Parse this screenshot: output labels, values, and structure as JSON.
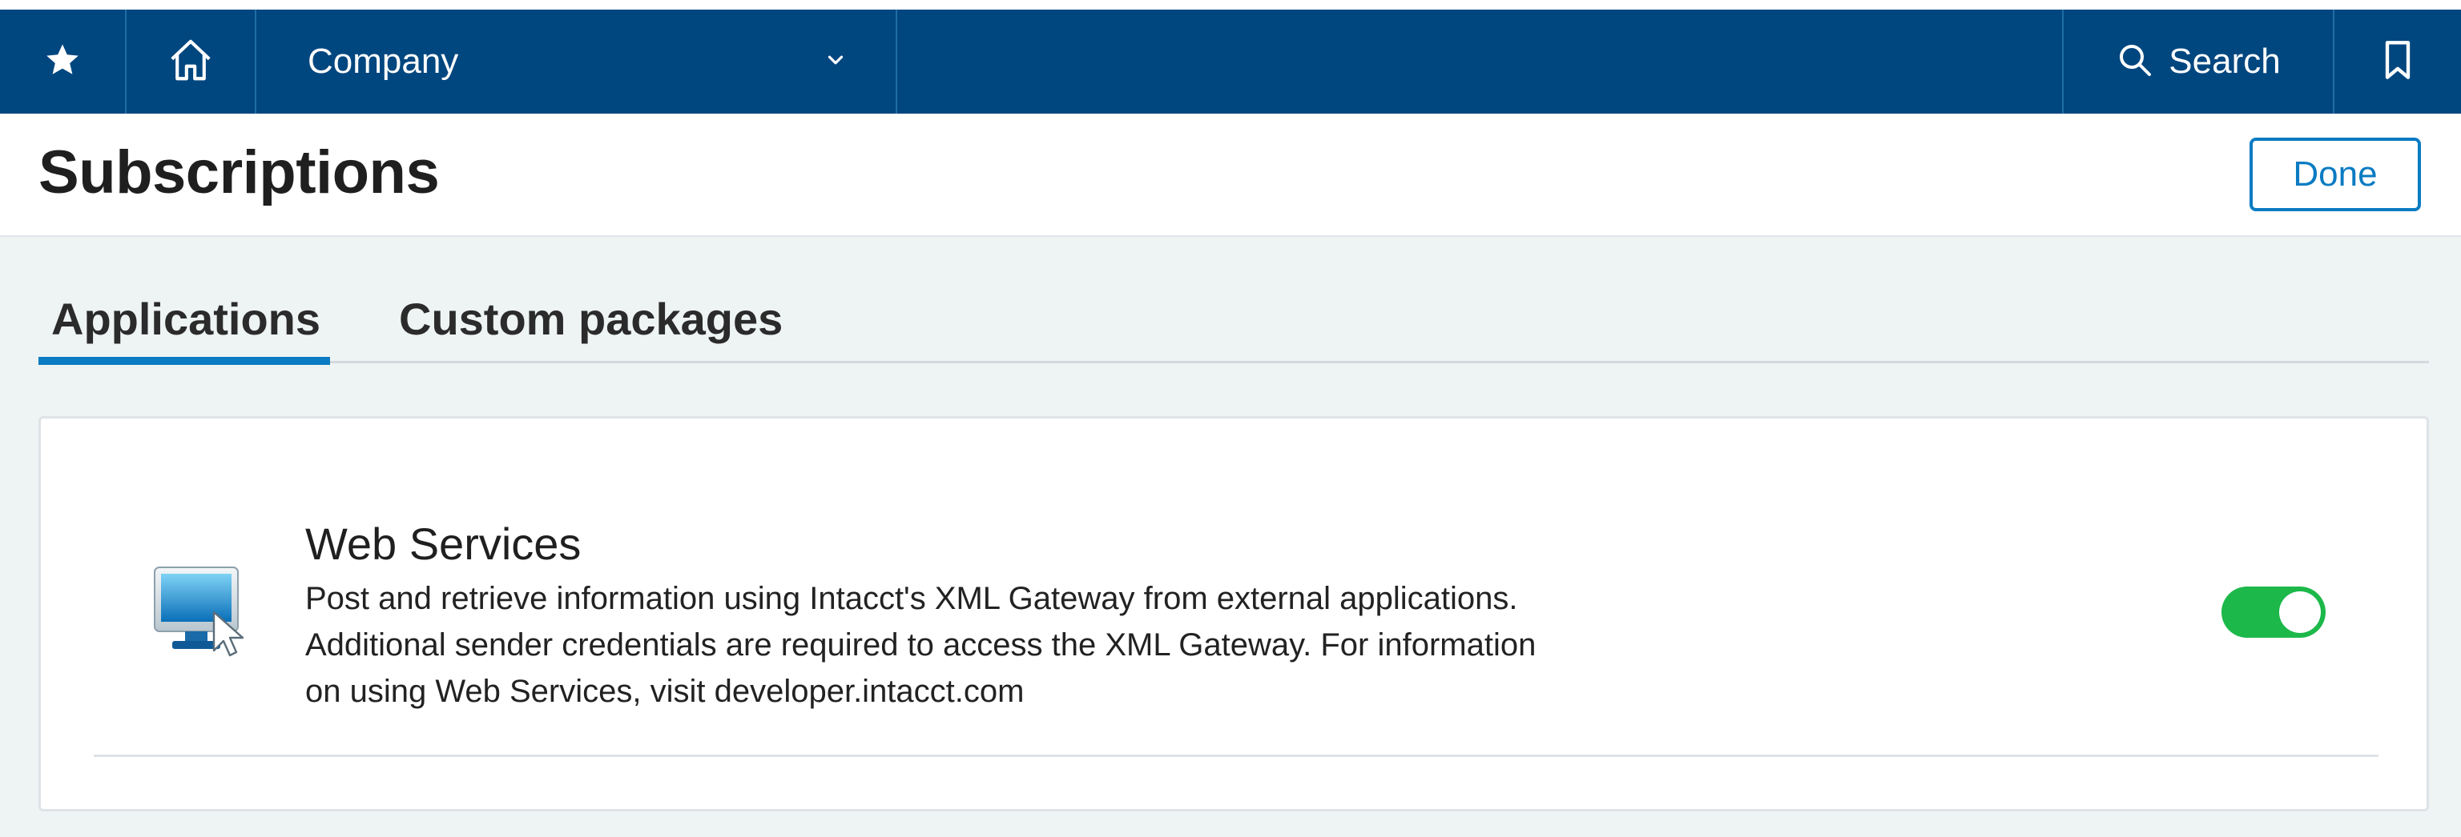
{
  "topbar": {
    "star_icon": "star-icon",
    "home_icon": "home-icon",
    "company_label": "Company",
    "company_chevron_icon": "chevron-down-icon",
    "search_label": "Search",
    "search_icon": "search-icon",
    "bookmark_icon": "bookmark-icon",
    "background_color": "#00467f"
  },
  "header": {
    "title": "Subscriptions",
    "done_label": "Done"
  },
  "tabs": [
    {
      "label": "Applications",
      "active": true
    },
    {
      "label": "Custom packages",
      "active": false
    }
  ],
  "applications": [
    {
      "icon": "computer-monitor-icon",
      "title": "Web Services",
      "description": "Post and retrieve information using Intacct's XML Gateway from external applications. Additional sender credentials are required to access the XML Gateway. For information on using Web Services, visit developer.intacct.com",
      "subscribed": true
    }
  ],
  "colors": {
    "accent": "#0a7bc2",
    "toggle_on": "#1cb84a"
  }
}
